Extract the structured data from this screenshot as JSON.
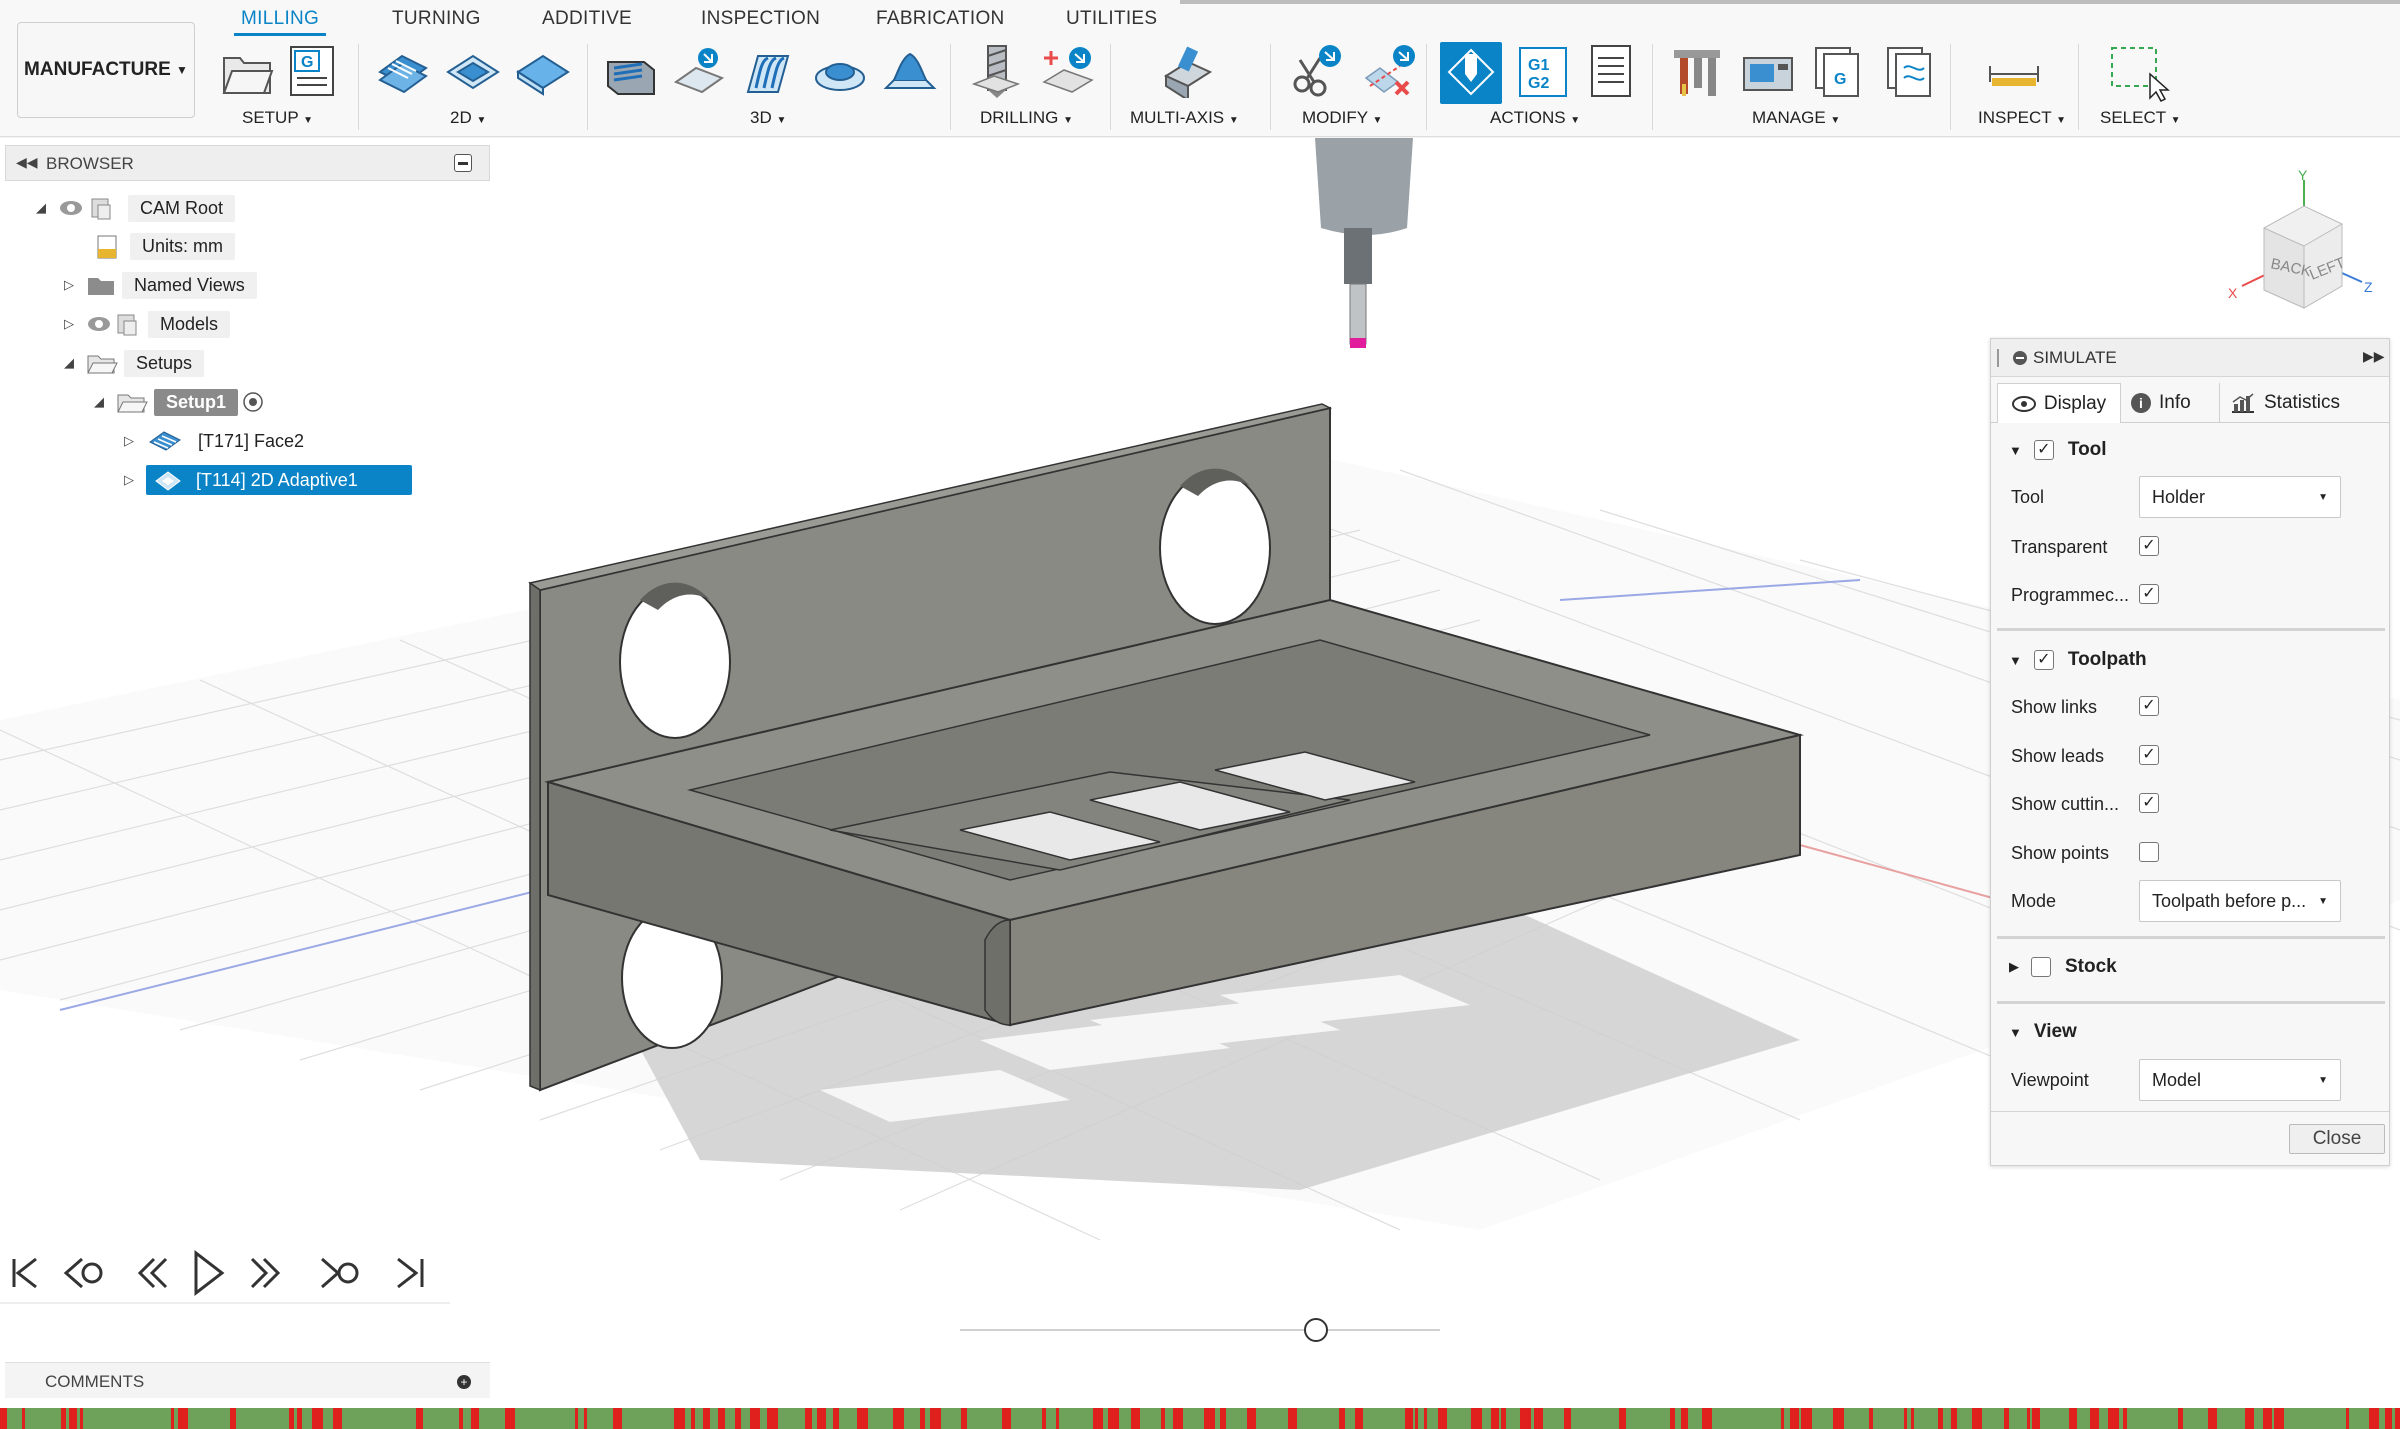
{
  "toolbar": {
    "workspace": "MANUFACTURE",
    "tabs": [
      "MILLING",
      "TURNING",
      "ADDITIVE",
      "INSPECTION",
      "FABRICATION",
      "UTILITIES"
    ],
    "active_tab": "MILLING",
    "groups": {
      "setup": "SETUP",
      "two_d": "2D",
      "three_d": "3D",
      "drilling": "DRILLING",
      "multi_axis": "MULTI-AXIS",
      "modify": "MODIFY",
      "actions": "ACTIONS",
      "manage": "MANAGE",
      "inspect": "INSPECT",
      "select": "SELECT"
    },
    "g_label": "G",
    "g1g2_top": "G1",
    "g1g2_bottom": "G2"
  },
  "browser": {
    "title": "BROWSER",
    "items": {
      "root": "CAM Root",
      "units": "Units: mm",
      "named_views": "Named Views",
      "models": "Models",
      "setups": "Setups",
      "setup1": "Setup1",
      "op1": "[T171] Face2",
      "op2": "[T114] 2D Adaptive1"
    }
  },
  "viewcube": {
    "back": "BACK",
    "left": "LEFT",
    "x": "X",
    "y": "Y",
    "z": "Z"
  },
  "simulate": {
    "title": "SIMULATE",
    "tabs": {
      "display": "Display",
      "info": "Info",
      "statistics": "Statistics"
    },
    "tool_section": "Tool",
    "tool_label": "Tool",
    "tool_value": "Holder",
    "transparent": "Transparent",
    "programmed": "Programmec...",
    "toolpath_section": "Toolpath",
    "show_links": "Show links",
    "show_leads": "Show leads",
    "show_cutting": "Show cuttin...",
    "show_points": "Show points",
    "mode_label": "Mode",
    "mode_value": "Toolpath before p...",
    "stock_section": "Stock",
    "view_section": "View",
    "viewpoint_label": "Viewpoint",
    "viewpoint_value": "Model",
    "close": "Close"
  },
  "comments": {
    "title": "COMMENTS"
  },
  "colors": {
    "accent": "#0a84c7",
    "timeline_green": "#6ea25a",
    "timeline_red": "#e0201c"
  }
}
